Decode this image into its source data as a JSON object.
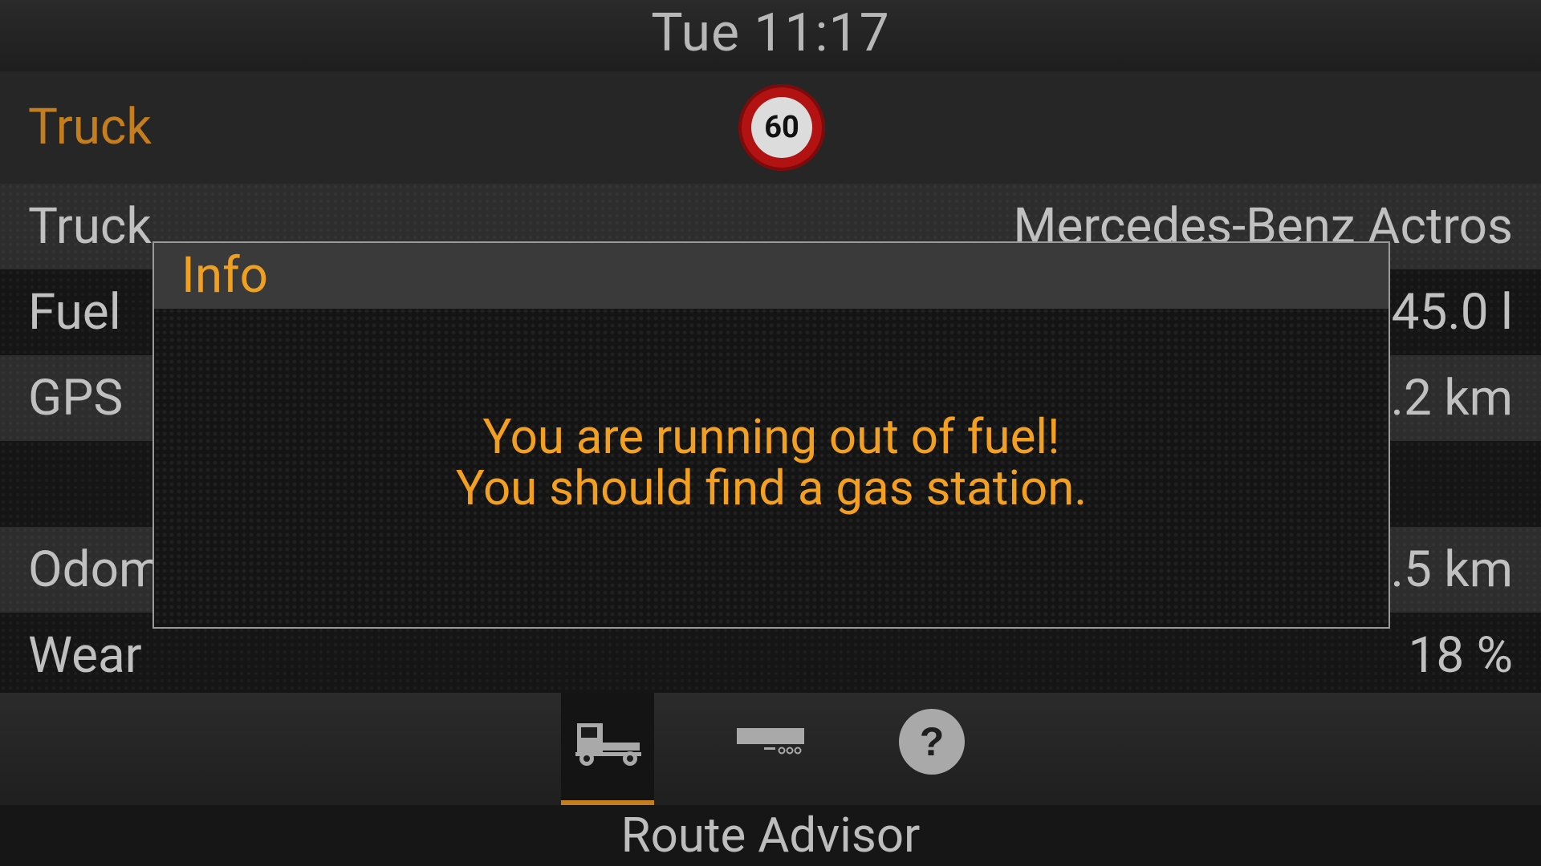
{
  "status_bar": {
    "clock": "Tue 11:17"
  },
  "header": {
    "section_title": "Truck",
    "speed_limit": "60"
  },
  "rows": [
    {
      "label": "Truck",
      "value": "Mercedes-Benz Actros"
    },
    {
      "label": "Fuel",
      "value": "45.0 l"
    },
    {
      "label": "GPS",
      "value": ".2 km"
    },
    {
      "label": "",
      "value": ""
    },
    {
      "label": "Odom",
      "value": ".5 km"
    },
    {
      "label": "Wear",
      "value": "18 %"
    }
  ],
  "nav": {
    "tabs": [
      {
        "icon": "truck-icon",
        "active": true
      },
      {
        "icon": "trailer-icon",
        "active": false
      },
      {
        "icon": "help-icon",
        "active": false
      }
    ],
    "footer_label": "Route Advisor"
  },
  "dialog": {
    "title": "Info",
    "message_line1": "You are running out of fuel!",
    "message_line2": "You should find a gas station."
  },
  "colors": {
    "accent": "#c57e1d",
    "dialog_text": "#f3a020",
    "speed_sign_red": "#b31212"
  }
}
